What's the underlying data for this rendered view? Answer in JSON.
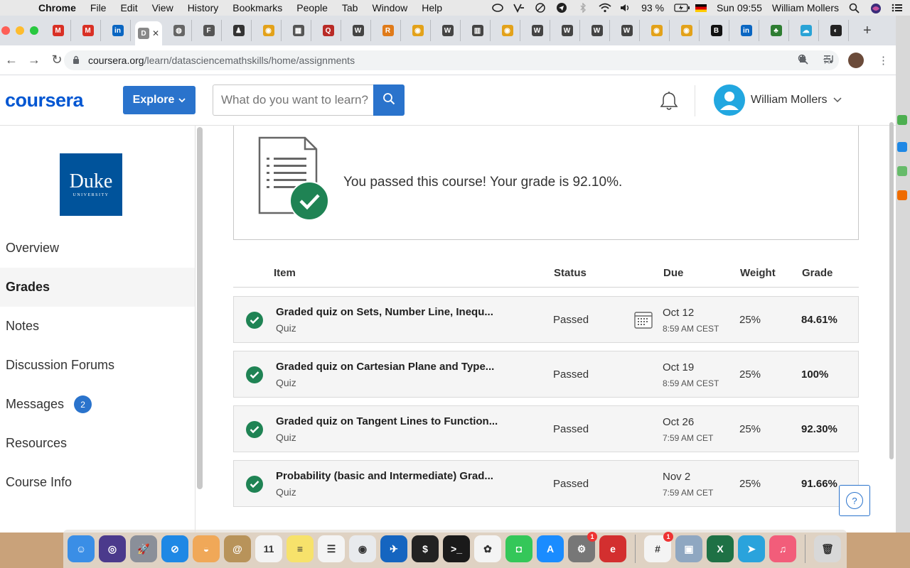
{
  "menubar": {
    "app": "Chrome",
    "items": [
      "File",
      "Edit",
      "View",
      "History",
      "Bookmarks",
      "People",
      "Tab",
      "Window",
      "Help"
    ],
    "battery": "93 %",
    "clock": "Sun 09:55",
    "user": "William Mollers"
  },
  "browser": {
    "tabs": [
      {
        "icon": "gmail-icon",
        "color": "#d93025",
        "glyph": "M"
      },
      {
        "icon": "gmail-icon",
        "color": "#d93025",
        "glyph": "M"
      },
      {
        "icon": "linkedin-icon",
        "color": "#0a66c2",
        "glyph": "in"
      },
      {
        "icon": "document-icon",
        "color": "#888888",
        "glyph": "D",
        "active": true
      },
      {
        "icon": "globe-icon",
        "color": "#666666",
        "glyph": "◍"
      },
      {
        "icon": "audio-icon",
        "color": "#555555",
        "glyph": "F"
      },
      {
        "icon": "profile-icon",
        "color": "#333333",
        "glyph": "♟"
      },
      {
        "icon": "chrome-icon",
        "color": "#e3a21a",
        "glyph": "◉"
      },
      {
        "icon": "calc-icon",
        "color": "#555555",
        "glyph": "▦"
      },
      {
        "icon": "quora-icon",
        "color": "#b92b27",
        "glyph": "Q"
      },
      {
        "icon": "wikipedia-icon",
        "color": "#444444",
        "glyph": "W"
      },
      {
        "icon": "r-icon",
        "color": "#e07b1a",
        "glyph": "R"
      },
      {
        "icon": "chrome-icon",
        "color": "#e3a21a",
        "glyph": "◉"
      },
      {
        "icon": "wikipedia-icon",
        "color": "#444444",
        "glyph": "W"
      },
      {
        "icon": "chart-icon",
        "color": "#444444",
        "glyph": "▥"
      },
      {
        "icon": "chrome-icon",
        "color": "#e3a21a",
        "glyph": "◉"
      },
      {
        "icon": "wikipedia-icon",
        "color": "#444444",
        "glyph": "W"
      },
      {
        "icon": "wikipedia-icon",
        "color": "#444444",
        "glyph": "W"
      },
      {
        "icon": "wikipedia-icon",
        "color": "#444444",
        "glyph": "W"
      },
      {
        "icon": "wikipedia-icon",
        "color": "#444444",
        "glyph": "W"
      },
      {
        "icon": "chrome-icon",
        "color": "#e3a21a",
        "glyph": "◉"
      },
      {
        "icon": "chrome-icon",
        "color": "#e3a21a",
        "glyph": "◉"
      },
      {
        "icon": "b-icon",
        "color": "#111111",
        "glyph": "B"
      },
      {
        "icon": "linkedin-icon",
        "color": "#0a66c2",
        "glyph": "in"
      },
      {
        "icon": "tree-icon",
        "color": "#2e7d32",
        "glyph": "♣"
      },
      {
        "icon": "cloud-icon",
        "color": "#29a3d6",
        "glyph": "☁"
      },
      {
        "icon": "github-icon",
        "color": "#222222",
        "glyph": "◐"
      }
    ],
    "url_host": "coursera.org",
    "url_path": "/learn/datasciencemathskills/home/assignments"
  },
  "header": {
    "logo": "coursera",
    "explore": "Explore",
    "search_placeholder": "What do you want to learn?",
    "user_name": "William Mollers"
  },
  "sidebar": {
    "university_name": "Duke",
    "university_sub": "UNIVERSITY",
    "items": [
      {
        "label": "Overview",
        "active": false
      },
      {
        "label": "Grades",
        "active": true
      },
      {
        "label": "Notes",
        "active": false
      },
      {
        "label": "Discussion Forums",
        "active": false
      },
      {
        "label": "Messages",
        "active": false,
        "badge": "2"
      },
      {
        "label": "Resources",
        "active": false
      },
      {
        "label": "Course Info",
        "active": false
      }
    ]
  },
  "main": {
    "pass_message": "You passed this course! Your grade is 92.10%.",
    "columns": {
      "item": "Item",
      "status": "Status",
      "due": "Due",
      "weight": "Weight",
      "grade": "Grade"
    },
    "rows": [
      {
        "title": "Graded quiz on Sets, Number Line, Inequ...",
        "type": "Quiz",
        "status": "Passed",
        "date": "Oct 12",
        "time": "8:59 AM CEST",
        "weight": "25%",
        "grade": "84.61%",
        "calendar": true
      },
      {
        "title": "Graded quiz on Cartesian Plane and Type...",
        "type": "Quiz",
        "status": "Passed",
        "date": "Oct 19",
        "time": "8:59 AM CEST",
        "weight": "25%",
        "grade": "100%",
        "calendar": false
      },
      {
        "title": "Graded quiz on Tangent Lines to Function...",
        "type": "Quiz",
        "status": "Passed",
        "date": "Oct 26",
        "time": "7:59 AM CET",
        "weight": "25%",
        "grade": "92.30%",
        "calendar": false
      },
      {
        "title": "Probability (basic and Intermediate) Grad...",
        "type": "Quiz",
        "status": "Passed",
        "date": "Nov 2",
        "time": "7:59 AM CET",
        "weight": "25%",
        "grade": "91.66%",
        "calendar": false
      }
    ],
    "help_label": "?"
  },
  "dock": {
    "apps": [
      {
        "name": "finder-icon",
        "color": "#3a8ee6",
        "glyph": "☺"
      },
      {
        "name": "siri-icon",
        "color": "#4b3a8c",
        "glyph": "◎"
      },
      {
        "name": "launchpad-icon",
        "color": "#8a8f99",
        "glyph": "🚀"
      },
      {
        "name": "safari-icon",
        "color": "#1e88e5",
        "glyph": "⊘"
      },
      {
        "name": "weather-icon",
        "color": "#f0a858",
        "glyph": "◒"
      },
      {
        "name": "contacts-icon",
        "color": "#b8935a",
        "glyph": "@"
      },
      {
        "name": "calendar-icon",
        "color": "#f4f4f4",
        "glyph": "11"
      },
      {
        "name": "notes-icon",
        "color": "#f7e26b",
        "glyph": "≡"
      },
      {
        "name": "reminders-icon",
        "color": "#f4f4f4",
        "glyph": "☰"
      },
      {
        "name": "chrome-icon",
        "color": "#e8eaed",
        "glyph": "◉"
      },
      {
        "name": "openoffice-icon",
        "color": "#1565c0",
        "glyph": "✈"
      },
      {
        "name": "terminal-icon",
        "color": "#222222",
        "glyph": "$"
      },
      {
        "name": "terminal-icon",
        "color": "#1a1a1a",
        "glyph": ">_"
      },
      {
        "name": "photos-icon",
        "color": "#f4f4f4",
        "glyph": "✿"
      },
      {
        "name": "facetime-icon",
        "color": "#34c759",
        "glyph": "◘"
      },
      {
        "name": "appstore-icon",
        "color": "#1a8cff",
        "glyph": "A"
      },
      {
        "name": "system-preferences-icon",
        "color": "#777777",
        "glyph": "⚙",
        "badge": "1"
      },
      {
        "name": "expressvpn-icon",
        "color": "#d32f2f",
        "glyph": "e"
      },
      {
        "name": "slack-icon",
        "color": "#f4f4f4",
        "glyph": "#",
        "badge": "1"
      },
      {
        "name": "preview-icon",
        "color": "#8fa7c1",
        "glyph": "▣"
      },
      {
        "name": "excel-icon",
        "color": "#1e7145",
        "glyph": "X"
      },
      {
        "name": "telegram-icon",
        "color": "#2aa3dc",
        "glyph": "➤"
      },
      {
        "name": "music-icon",
        "color": "#f25d7a",
        "glyph": "♫"
      },
      {
        "name": "trash-icon",
        "color": "#d8d8d8",
        "glyph": "🗑"
      }
    ]
  }
}
